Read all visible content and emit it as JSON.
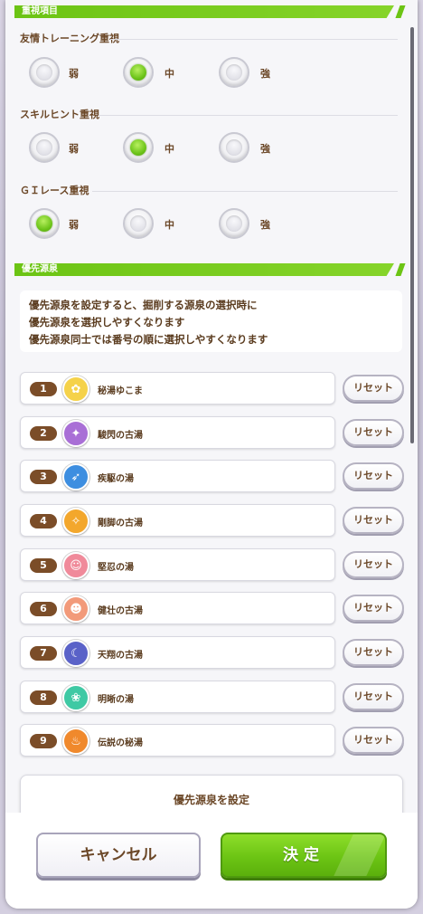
{
  "priority_section": {
    "title": "重視項目",
    "options": [
      {
        "label": "友情トレーニング重視",
        "selected": "中"
      },
      {
        "label": "スキルヒント重視",
        "selected": "中"
      },
      {
        "label": "ＧＩレース重視",
        "selected": "弱"
      }
    ],
    "levels": [
      "弱",
      "中",
      "強"
    ]
  },
  "spring_section": {
    "title": "優先源泉",
    "description": [
      "優先源泉を設定すると、掘削する源泉の選択時に",
      "優先源泉を選択しやすくなります",
      "優先源泉同士では番号の順に選択しやすくなります"
    ],
    "reset_label": "リセット",
    "springs": [
      {
        "number": "1",
        "name": "秘湯ゆこま",
        "icon": "yukoma-icon",
        "color": "#f5d24a"
      },
      {
        "number": "2",
        "name": "駿閃の古湯",
        "icon": "shunsen-icon",
        "color": "#a96fd6"
      },
      {
        "number": "3",
        "name": "疾駆の湯",
        "icon": "shikku-icon",
        "color": "#3d8ee0"
      },
      {
        "number": "4",
        "name": "剛脚の古湯",
        "icon": "gokyaku-icon",
        "color": "#f3a72c"
      },
      {
        "number": "5",
        "name": "堅忍の湯",
        "icon": "kennin-icon",
        "color": "#f08a9a"
      },
      {
        "number": "6",
        "name": "健壮の古湯",
        "icon": "kenso-icon",
        "color": "#f29a7a"
      },
      {
        "number": "7",
        "name": "天翔の古湯",
        "icon": "tensho-icon",
        "color": "#5a62c8"
      },
      {
        "number": "8",
        "name": "明晰の湯",
        "icon": "meiseki-icon",
        "color": "#3fc9a4"
      },
      {
        "number": "9",
        "name": "伝説の秘湯",
        "icon": "densetsu-icon",
        "color": "#f0892c"
      }
    ],
    "set_priority_label": "優先源泉を設定"
  },
  "footer": {
    "cancel_label": "キャンセル",
    "ok_label": "決定"
  }
}
